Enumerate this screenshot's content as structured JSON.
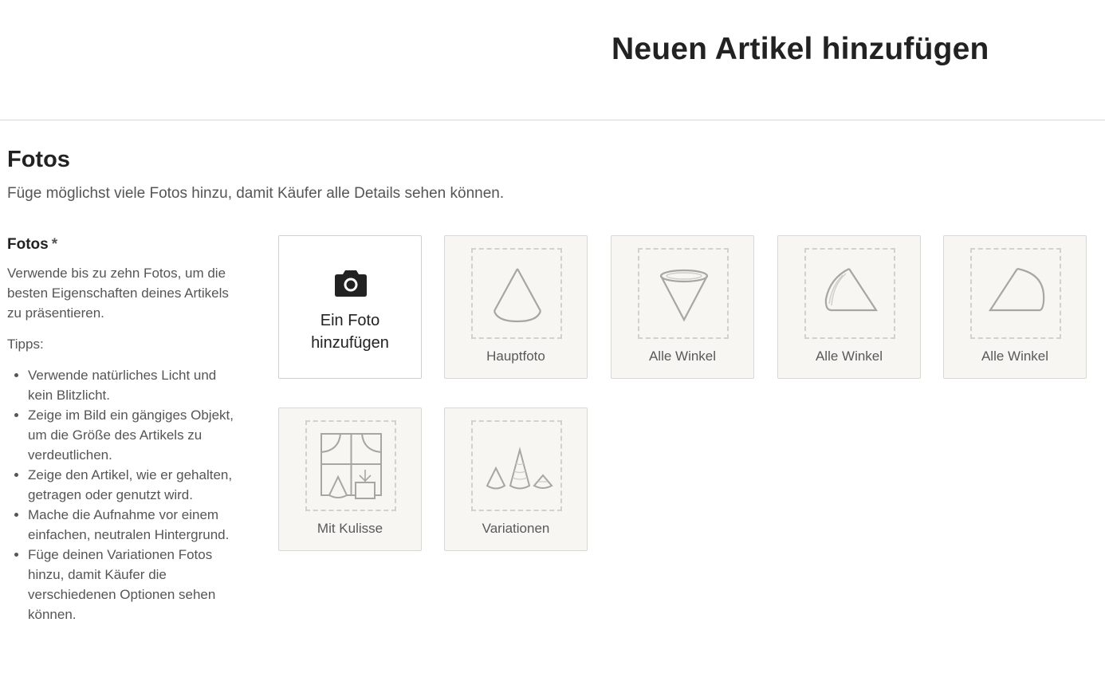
{
  "header": {
    "title": "Neuen Artikel hinzufügen"
  },
  "section": {
    "title": "Fotos",
    "subtitle": "Füge möglichst viele Fotos hinzu, damit Käufer alle Details sehen können."
  },
  "photos_field": {
    "label": "Fotos",
    "required_mark": "*",
    "description": "Verwende bis zu zehn Fotos, um die besten Eigenschaften deines Artikels zu präsentieren.",
    "tips_label": "Tipps:",
    "tips": [
      "Verwende natürliches Licht und kein Blitzlicht.",
      "Zeige im Bild ein gängiges Objekt, um die Größe des Artikels zu verdeutlichen.",
      "Zeige den Artikel, wie er gehalten, getragen oder genutzt wird.",
      "Mache die Aufnahme vor einem einfachen, neutralen Hintergrund.",
      "Füge deinen Variationen Fotos hinzu, damit Käufer die verschiedenen Optionen sehen können."
    ]
  },
  "upload": {
    "add_label_line1": "Ein Foto",
    "add_label_line2": "hinzufügen",
    "add_icon": "camera-icon",
    "slots": [
      {
        "label": "Hauptfoto",
        "icon": "cone-upright-icon"
      },
      {
        "label": "Alle Winkel",
        "icon": "cone-inverted-icon"
      },
      {
        "label": "Alle Winkel",
        "icon": "cone-tilted-icon"
      },
      {
        "label": "Alle Winkel",
        "icon": "cone-side-icon"
      },
      {
        "label": "Mit Kulisse",
        "icon": "window-scene-icon"
      },
      {
        "label": "Variationen",
        "icon": "three-cones-icon"
      }
    ]
  },
  "colors": {
    "text_primary": "#222222",
    "text_secondary": "#555555",
    "tile_background": "#f7f6f3",
    "tile_border": "#d9d7d2",
    "illustration_stroke": "#a8a6a1"
  }
}
